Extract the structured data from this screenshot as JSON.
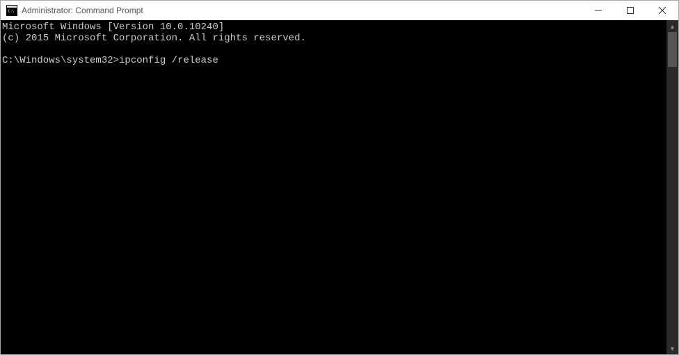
{
  "titlebar": {
    "title": "Administrator: Command Prompt"
  },
  "terminal": {
    "line1": "Microsoft Windows [Version 10.0.10240]",
    "line2": "(c) 2015 Microsoft Corporation. All rights reserved.",
    "blank": "",
    "prompt": "C:\\Windows\\system32>",
    "command": "ipconfig /release"
  }
}
